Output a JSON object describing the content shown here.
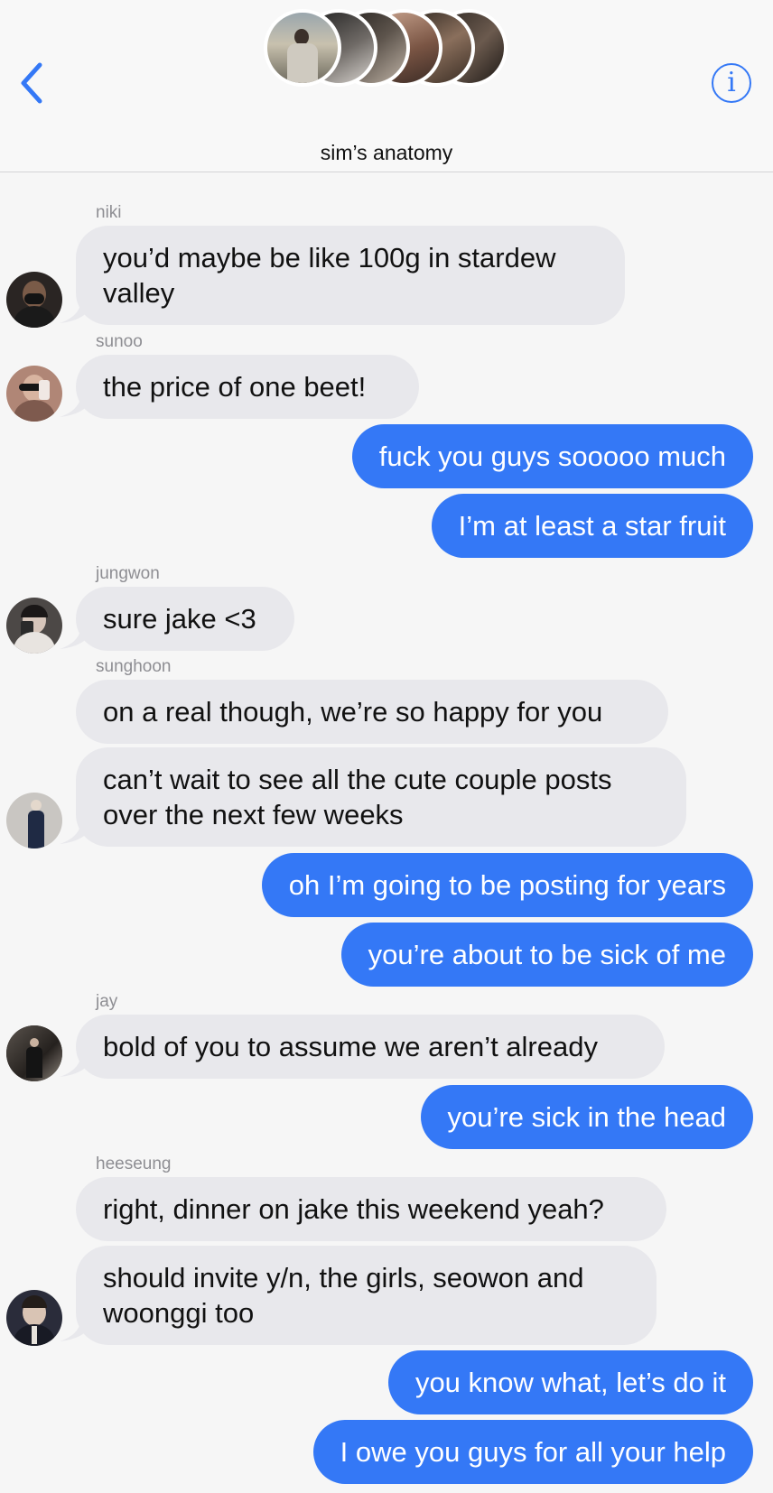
{
  "header": {
    "title": "sim’s anatomy",
    "back_icon": "chevron-left-icon",
    "info_icon": "info-icon",
    "accent_color": "#3478f6"
  },
  "messages": [
    {
      "sender": "niki",
      "direction": "in",
      "lines": [
        "you’d maybe be like 100g in stardew",
        "valley"
      ],
      "avatar": "niki-avatar"
    },
    {
      "sender": "sunoo",
      "direction": "in",
      "lines": [
        "the price of one beet!"
      ],
      "avatar": "sunoo-avatar"
    },
    {
      "direction": "out",
      "lines": [
        "fuck you guys sooooo much"
      ]
    },
    {
      "direction": "out",
      "lines": [
        "I’m at least a star fruit"
      ]
    },
    {
      "sender": "jungwon",
      "direction": "in",
      "lines": [
        "sure jake <3"
      ],
      "avatar": "jungwon-avatar"
    },
    {
      "sender": "sunghoon",
      "direction": "in",
      "lines": [
        "on a real though, we’re so happy for you"
      ]
    },
    {
      "direction": "in",
      "lines": [
        "can’t wait to see all the cute couple posts",
        "over the next few weeks"
      ],
      "avatar": "sunghoon-avatar"
    },
    {
      "direction": "out",
      "lines": [
        "oh I’m going to be posting for years"
      ]
    },
    {
      "direction": "out",
      "lines": [
        "you’re about to be sick of me"
      ]
    },
    {
      "sender": "jay",
      "direction": "in",
      "lines": [
        "bold of you to assume we aren’t already"
      ],
      "avatar": "jay-avatar"
    },
    {
      "direction": "out",
      "lines": [
        "you’re sick in the head"
      ]
    },
    {
      "sender": "heeseung",
      "direction": "in",
      "lines": [
        "right, dinner on jake this weekend yeah?"
      ]
    },
    {
      "direction": "in",
      "lines": [
        "should invite y/n, the girls, seowon and",
        "woonggi too"
      ],
      "avatar": "heeseung-avatar"
    },
    {
      "direction": "out",
      "lines": [
        "you know what, let’s do it"
      ]
    },
    {
      "direction": "out",
      "lines": [
        "I owe you guys for all your help"
      ]
    }
  ]
}
